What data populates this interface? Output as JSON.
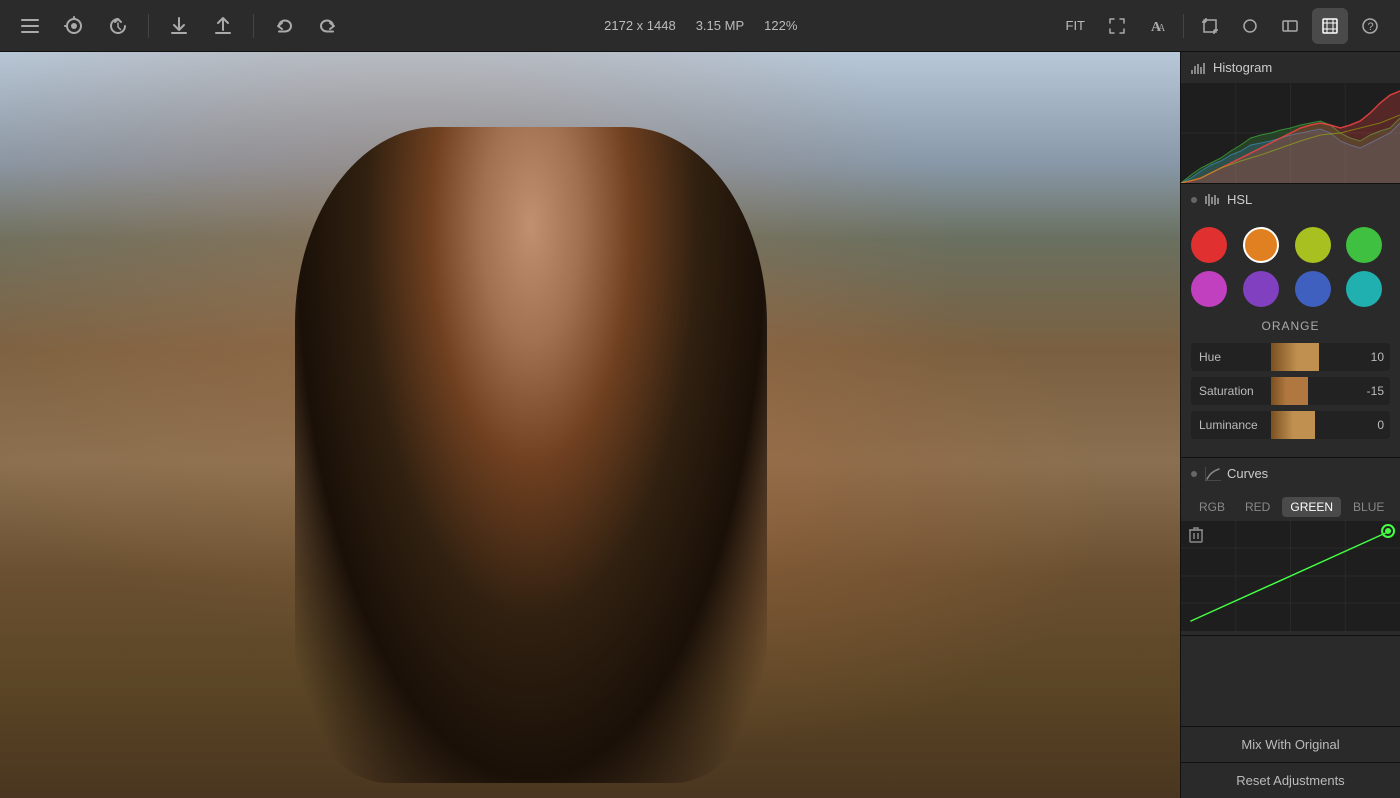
{
  "toolbar": {
    "image_info": {
      "dimensions": "2172 x 1448",
      "megapixels": "3.15 MP",
      "zoom": "122%"
    },
    "fit_label": "FIT",
    "buttons": {
      "menu": "☰",
      "sync": "↻",
      "history": "↺",
      "download": "↓",
      "share": "↑",
      "undo": "←",
      "redo": "→"
    },
    "tools": [
      {
        "name": "text-tool",
        "icon": "A",
        "label": "Text",
        "active": false
      },
      {
        "name": "aa-tool",
        "icon": "A/",
        "label": "AA",
        "active": false
      },
      {
        "name": "crop-tool",
        "icon": "⊡",
        "label": "Crop",
        "active": false
      },
      {
        "name": "circle-tool",
        "icon": "○",
        "label": "Circle",
        "active": false
      },
      {
        "name": "panel-tool",
        "icon": "▭",
        "label": "Panel",
        "active": false
      },
      {
        "name": "select-tool",
        "icon": "⊠",
        "label": "Select",
        "active": true
      },
      {
        "name": "help",
        "icon": "?",
        "label": "Help",
        "active": false
      }
    ]
  },
  "histogram": {
    "label": "Histogram"
  },
  "hsl": {
    "label": "HSL",
    "colors": [
      {
        "name": "red",
        "hex": "#e03030",
        "label": "Red",
        "active": false
      },
      {
        "name": "orange",
        "hex": "#e08020",
        "label": "Orange",
        "active": true
      },
      {
        "name": "yellow-green",
        "hex": "#a8c020",
        "label": "Yellow-Green",
        "active": false
      },
      {
        "name": "green",
        "hex": "#40c040",
        "label": "Green",
        "active": false
      },
      {
        "name": "purple",
        "hex": "#c040c0",
        "label": "Purple",
        "active": false
      },
      {
        "name": "violet",
        "hex": "#8040c0",
        "label": "Violet",
        "active": false
      },
      {
        "name": "blue",
        "hex": "#4060c0",
        "label": "Blue",
        "active": false
      },
      {
        "name": "cyan",
        "hex": "#20b0b0",
        "label": "Cyan",
        "active": false
      }
    ],
    "selected_color_label": "ORANGE",
    "sliders": {
      "hue": {
        "label": "Hue",
        "value": 10,
        "min": -100,
        "max": 100,
        "percent": 55
      },
      "saturation": {
        "label": "Saturation",
        "value": -15,
        "min": -100,
        "max": 100,
        "percent": 42
      },
      "luminance": {
        "label": "Luminance",
        "value": 0,
        "min": -100,
        "max": 100,
        "percent": 50
      }
    }
  },
  "curves": {
    "label": "Curves",
    "tabs": [
      {
        "name": "rgb",
        "label": "RGB",
        "active": false
      },
      {
        "name": "red",
        "label": "RED",
        "active": false
      },
      {
        "name": "green",
        "label": "GREEN",
        "active": true
      },
      {
        "name": "blue",
        "label": "BLUE",
        "active": false
      }
    ]
  },
  "bottom_buttons": [
    {
      "name": "mix-with-original",
      "label": "Mix With Original"
    },
    {
      "name": "reset-adjustments",
      "label": "Reset Adjustments"
    }
  ]
}
